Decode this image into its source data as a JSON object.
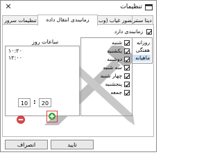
{
  "window": {
    "title": "تنظیمات",
    "close_glyph": "✕"
  },
  "tabs": [
    {
      "label": "دیتا سنتر",
      "active": false
    },
    {
      "label": "حضور غیاب (وب)",
      "active": false
    },
    {
      "label": "زمانبندی انتقال داده",
      "active": true
    },
    {
      "label": "تنظیمات سرور",
      "active": false
    }
  ],
  "schedule": {
    "enabled_label": "زمانبندی دارد",
    "enabled": true,
    "periods": [
      {
        "label": "روزانه",
        "selected": false
      },
      {
        "label": "هفتگی",
        "selected": false
      },
      {
        "label": "ماهیانه",
        "selected": true
      }
    ],
    "days": [
      {
        "label": "شنبه",
        "checked": true
      },
      {
        "label": "یکشنبه",
        "checked": true
      },
      {
        "label": "دوشنبه",
        "checked": true
      },
      {
        "label": "سه شنبه",
        "checked": true
      },
      {
        "label": "چهار شنبه",
        "checked": true
      },
      {
        "label": "پنجشنبه",
        "checked": true
      },
      {
        "label": "جمعه",
        "checked": true
      }
    ],
    "hours_label": "ساعات روز",
    "hours": [
      "۱۰:۲۰",
      "۱۲:۰۰"
    ],
    "time": {
      "hour": "10",
      "separator": ":",
      "minute": "20"
    }
  },
  "buttons": {
    "ok": "تایید",
    "cancel": "انصراف"
  },
  "colors": {
    "remove": "#e04848",
    "add": "#3fae3f",
    "highlight": "#e53b3b",
    "selection": "#cfe3f7"
  }
}
